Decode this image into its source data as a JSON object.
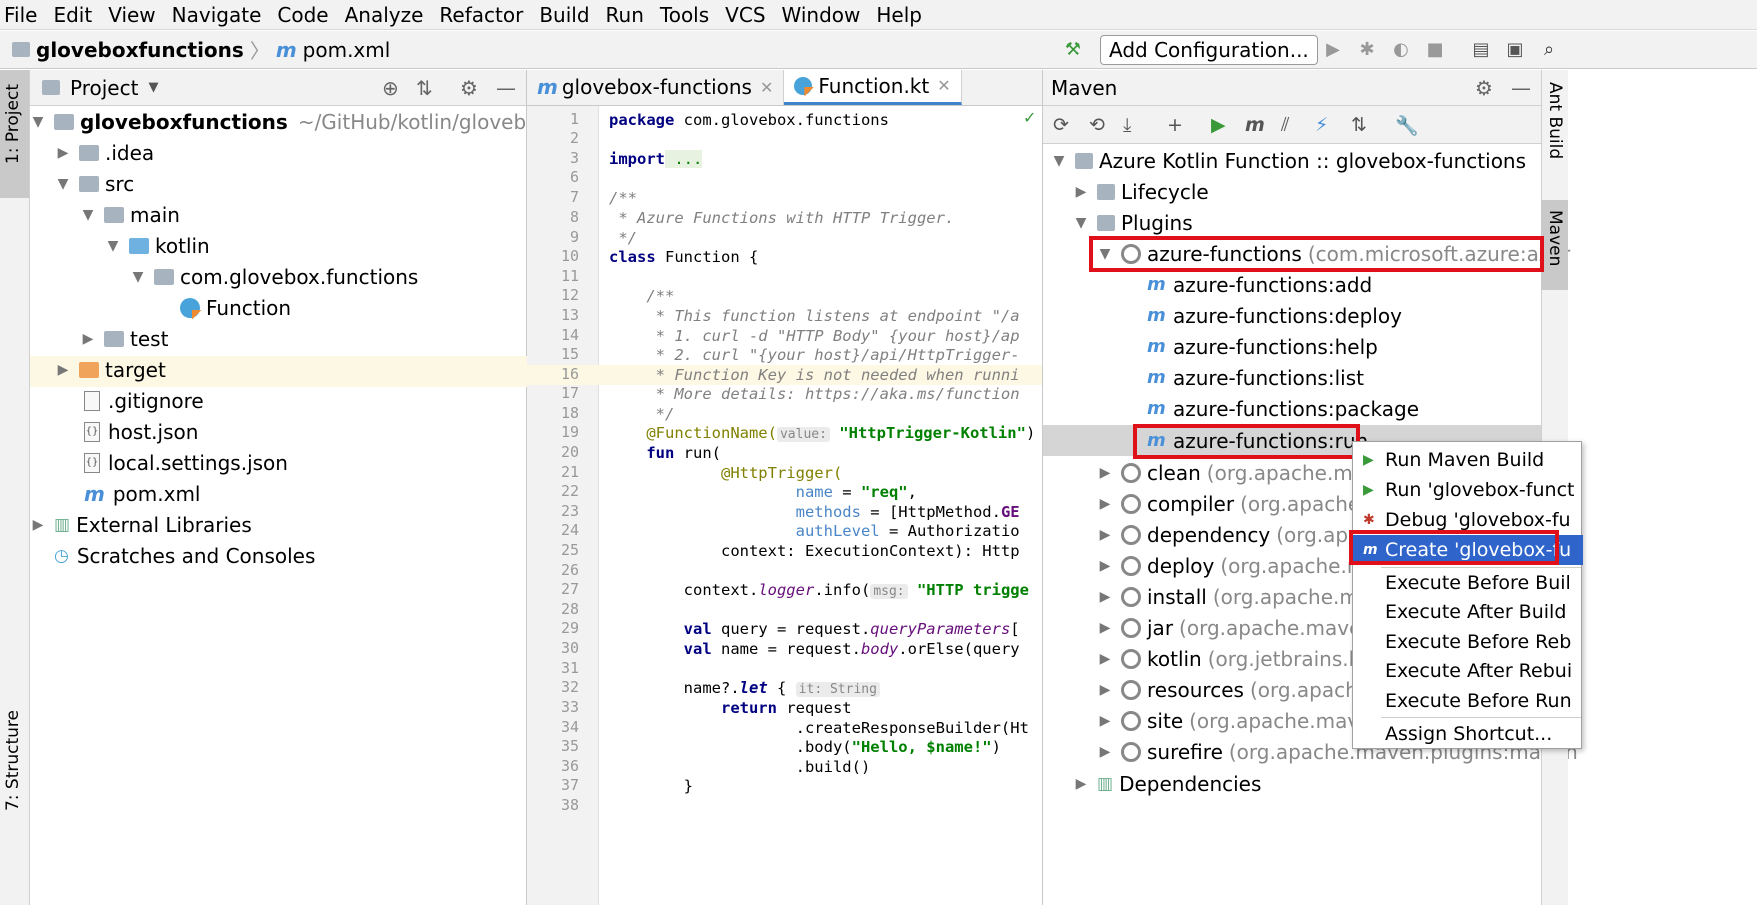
{
  "menu": [
    "File",
    "Edit",
    "View",
    "Navigate",
    "Code",
    "Analyze",
    "Refactor",
    "Build",
    "Run",
    "Tools",
    "VCS",
    "Window",
    "Help"
  ],
  "breadcrumb": {
    "project": "gloveboxfunctions",
    "file": "pom.xml"
  },
  "toolbar": {
    "add_config": "Add Configuration..."
  },
  "leftstrip": {
    "project_tab": "1: Project",
    "structure_tab": "7: Structure"
  },
  "rightstrip": {
    "ant_tab": "Ant Build",
    "maven_tab": "Maven"
  },
  "project": {
    "title": "Project",
    "root_name": "gloveboxfunctions",
    "root_path": "~/GitHub/kotlin/gloveboxf",
    "items": [
      ".idea",
      "src",
      "main",
      "kotlin",
      "com.glovebox.functions",
      "Function",
      "test",
      "target",
      ".gitignore",
      "host.json",
      "local.settings.json",
      "pom.xml",
      "External Libraries",
      "Scratches and Consoles"
    ]
  },
  "editor": {
    "tabs": [
      "glovebox-functions",
      "Function.kt"
    ],
    "line_numbers": [
      "1",
      "2",
      "3",
      "6",
      "7",
      "8",
      "9",
      "10",
      "11",
      "12",
      "13",
      "14",
      "15",
      "16",
      "17",
      "18",
      "19",
      "20",
      "21",
      "22",
      "23",
      "24",
      "25",
      "26",
      "27",
      "28",
      "29",
      "30",
      "31",
      "32",
      "33",
      "34",
      "35",
      "36",
      "37",
      "38"
    ],
    "lines": {
      "l1a": "package",
      "l1b": " com.glovebox.functions",
      "l3a": "import",
      "l3b": " ...",
      "l7": "/**",
      "l8": " * Azure Functions with HTTP Trigger.",
      "l9": " */",
      "l10a": "class",
      "l10b": " Function {",
      "l12": "    /**",
      "l13": "     * This function listens at endpoint \"/a",
      "l14": "     * 1. curl -d \"HTTP Body\" {your host}/ap",
      "l15": "     * 2. curl \"{your host}/api/HttpTrigger-",
      "l16": "     * Function Key is not needed when runni",
      "l17": "     * More details: https://aka.ms/function",
      "l18": "     */",
      "l19a": "    @FunctionName(",
      "l19hint": "value:",
      "l19str": "\"HttpTrigger-Kotlin\"",
      "l19c": ")",
      "l20a": "    fun",
      "l20b": " run(",
      "l21": "            @HttpTrigger(",
      "l22a": "                    name",
      "l22b": " = ",
      "l22c": "\"req\"",
      "l22d": ",",
      "l23a": "                    methods",
      "l23b": " = [HttpMethod.",
      "l23c": "GE",
      "l24a": "                    authLevel",
      "l24b": " = Authorizatio",
      "l25": "            context: ExecutionContext): Http",
      "l27a": "        context.",
      "l27b": "logger",
      "l27c": ".info(",
      "l27hint": "msg:",
      "l27str": "\"HTTP trigge",
      "l29a": "        val",
      "l29b": " query = request.",
      "l29c": "queryParameters",
      "l29d": "[",
      "l30a": "        val",
      "l30b": " name = request.",
      "l30c": "body",
      "l30d": ".orElse(query",
      "l32a": "        name?.",
      "l32b": "let",
      "l32c": " {",
      "l32hint": "it: String",
      "l33a": "            return",
      "l33b": " request",
      "l34": "                    .createResponseBuilder(Ht",
      "l35a": "                    .body(",
      "l35b": "\"Hello, $name!\"",
      "l35c": ")",
      "l36": "                    .build()",
      "l37": "        }"
    }
  },
  "maven": {
    "title": "Maven",
    "root": "Azure Kotlin Function :: glovebox-functions",
    "lifecycle": "Lifecycle",
    "plugins": "Plugins",
    "azure_plugin": "azure-functions",
    "azure_plugin_group": "(com.microsoft.azure:azur",
    "goals": [
      "azure-functions:add",
      "azure-functions:deploy",
      "azure-functions:help",
      "azure-functions:list",
      "azure-functions:package",
      "azure-functions:run"
    ],
    "other_plugins": [
      {
        "name": "clean",
        "group": "(org.apache.mav"
      },
      {
        "name": "compiler",
        "group": "(org.apache."
      },
      {
        "name": "dependency",
        "group": "(org.apac"
      },
      {
        "name": "deploy",
        "group": "(org.apache.ma"
      },
      {
        "name": "install",
        "group": "(org.apache.ma"
      },
      {
        "name": "jar",
        "group": "(org.apache.maven"
      },
      {
        "name": "kotlin",
        "group": "(org.jetbrains.ko"
      },
      {
        "name": "resources",
        "group": "(org.apache"
      },
      {
        "name": "site",
        "group": "(org.apache.mave"
      },
      {
        "name": "surefire",
        "group": "(org.apache.maven.plugins:maven"
      }
    ],
    "dependencies": "Dependencies"
  },
  "context_menu": {
    "items": [
      "Run Maven Build",
      "Run 'glovebox-funct",
      "Debug 'glovebox-fu",
      "Create 'glovebox-fu",
      "Execute Before Buil",
      "Execute After Build",
      "Execute Before Reb",
      "Execute After Rebui",
      "Execute Before Run",
      "Assign Shortcut..."
    ]
  },
  "colors": {
    "highlight_box": "#e0101a",
    "selection": "#2f65ca",
    "maven_icon": "#4a90d9"
  }
}
